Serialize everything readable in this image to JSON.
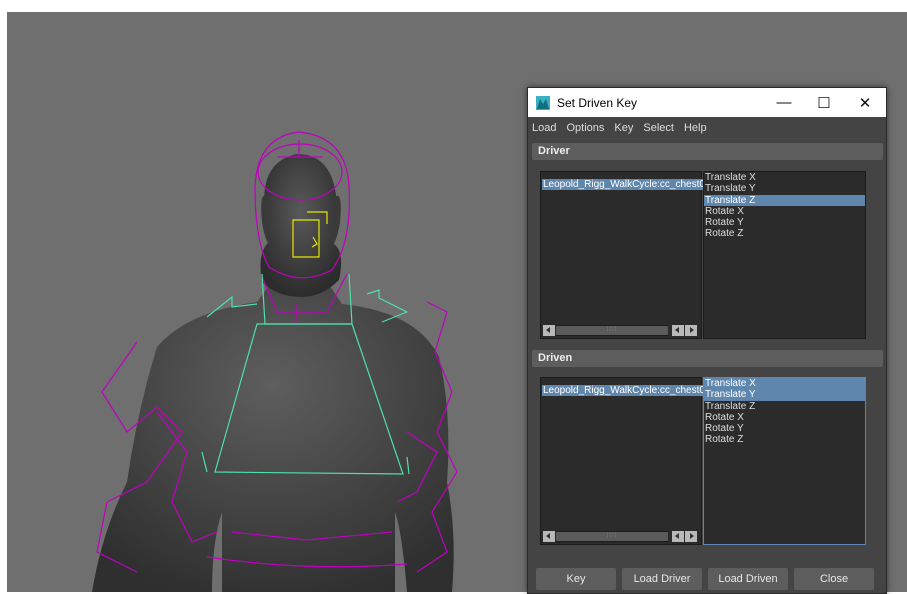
{
  "window": {
    "title": "Set Driven Key",
    "controls": {
      "minimize": "—",
      "maximize": "☐",
      "close": "✕"
    }
  },
  "menu": [
    "Load",
    "Options",
    "Key",
    "Select",
    "Help"
  ],
  "driver": {
    "header": "Driver",
    "object": "Leopold_Rigg_WalkCycle:cc_chest0",
    "attributes": [
      "Translate X",
      "Translate Y",
      "Translate Z",
      "Rotate X",
      "Rotate Y",
      "Rotate Z"
    ],
    "selected_attribute": "Translate Z"
  },
  "driven": {
    "header": "Driven",
    "object": "Leopold_Rigg_WalkCycle:cc_chest0",
    "attributes": [
      "Translate X",
      "Translate Y",
      "Translate Z",
      "Rotate X",
      "Rotate Y",
      "Rotate Z"
    ],
    "selected_attributes": [
      "Translate X",
      "Translate Y"
    ]
  },
  "buttons": {
    "key": "Key",
    "load_driver": "Load Driver",
    "load_driven": "Load Driven",
    "close": "Close"
  },
  "colors": {
    "viewport_bg": "#6f6f6f",
    "selection": "#5f87ae",
    "rig_curve": "#c000c0",
    "chest_control": "#4fe0a8",
    "face_control": "#e6e600"
  }
}
